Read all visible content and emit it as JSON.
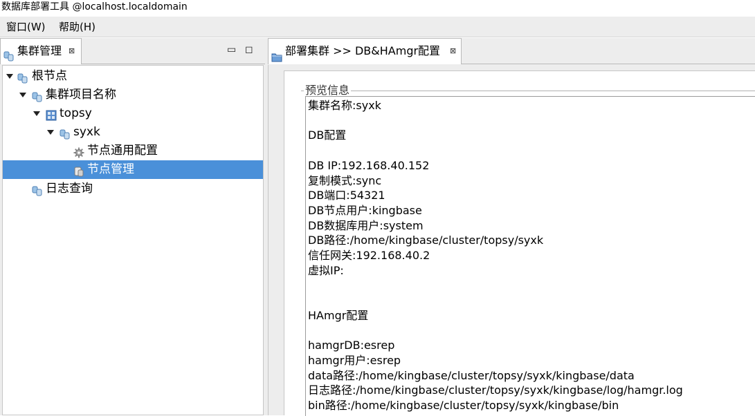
{
  "app": {
    "title": "数据库部署工具 @localhost.localdomain"
  },
  "menubar": {
    "items": [
      {
        "label": "窗口(W)"
      },
      {
        "label": "帮助(H)"
      }
    ]
  },
  "left_panel": {
    "tab_label": "集群管理",
    "tab_close": "⊠",
    "minimize": "▭",
    "maximize": "◻",
    "tree": [
      {
        "label": "根节点",
        "icon": "cluster-icon",
        "expanded": true
      },
      {
        "label": "集群项目名称",
        "icon": "cluster-icon",
        "expanded": true
      },
      {
        "label": "topsy",
        "icon": "grid-icon",
        "expanded": true
      },
      {
        "label": "syxk",
        "icon": "cluster-icon",
        "expanded": true
      },
      {
        "label": "节点通用配置",
        "icon": "gear-icon"
      },
      {
        "label": "节点管理",
        "icon": "database-icon",
        "selected": true
      },
      {
        "label": "日志查询",
        "icon": "cluster-icon"
      }
    ]
  },
  "right_panel": {
    "tab_label": "部署集群 >> DB&HAmgr配置",
    "tab_close": "⊠",
    "group_title": "预览信息",
    "preview_lines": [
      "集群名称:syxk",
      "",
      "DB配置",
      "",
      "DB IP:192.168.40.152",
      "复制模式:sync",
      "DB端口:54321",
      "DB节点用户:kingbase",
      "DB数据库用户:system",
      "DB路径:/home/kingbase/cluster/topsy/syxk",
      "信任网关:192.168.40.2",
      "虚拟IP:",
      "",
      "",
      "HAmgr配置",
      "",
      "hamgrDB:esrep",
      "hamgr用户:esrep",
      "data路径:/home/kingbase/cluster/topsy/syxk/kingbase/data",
      "日志路径:/home/kingbase/cluster/topsy/syxk/kingbase/log/hamgr.log",
      "bin路径:/home/kingbase/cluster/topsy/syxk/kingbase/bin"
    ]
  },
  "colors": {
    "selection": "#4a90d9",
    "chrome": "#ededed"
  }
}
